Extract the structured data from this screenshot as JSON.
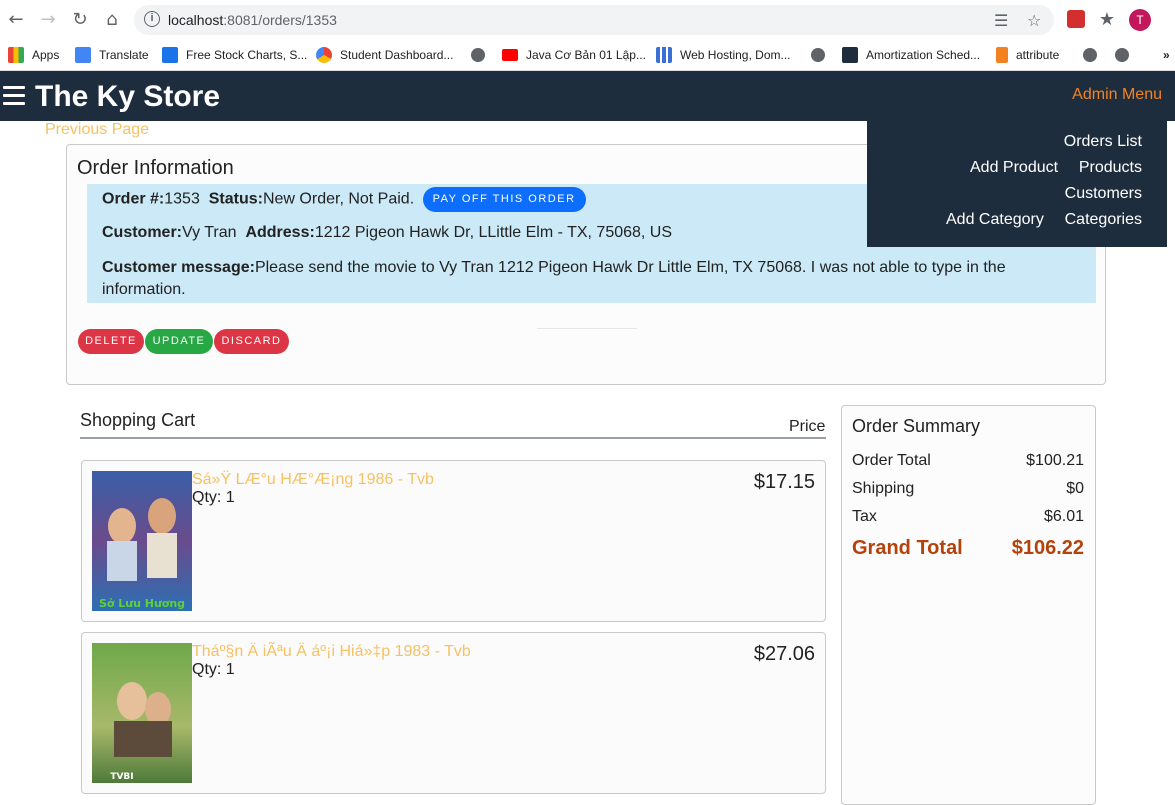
{
  "browser": {
    "url_host": "localhost",
    "url_rest": ":8081/orders/1353",
    "avatar_letter": "T",
    "bookmarks": [
      {
        "label": "Apps",
        "icon": "apps-grid-icon"
      },
      {
        "label": "Translate",
        "icon": "translate-icon"
      },
      {
        "label": "Free Stock Charts, S...",
        "icon": "chart-cloud-icon"
      },
      {
        "label": "Student Dashboard...",
        "icon": "dashboard-icon"
      },
      {
        "label": "Java Cơ Bản 01 Lập...",
        "icon": "youtube-icon"
      },
      {
        "label": "Web Hosting, Dom...",
        "icon": "grid-icon"
      },
      {
        "label": "Amortization Sched...",
        "icon": "b-logo-icon"
      },
      {
        "label": "attribute",
        "icon": "bookmark-icon"
      }
    ]
  },
  "navbar": {
    "brand": "The Ky Store",
    "admin_menu": "Admin Menu",
    "dropdown": {
      "orders_list": "Orders List",
      "add_product": "Add Product",
      "products": "Products",
      "customers": "Customers",
      "add_category": "Add Category",
      "categories": "Categories"
    }
  },
  "prev_page": "Previous Page",
  "order": {
    "title": "Order Information",
    "number_label": "Order #:",
    "number": "1353",
    "status_label": "Status:",
    "status": "New Order, Not Paid.",
    "pay_button": "PAY OFF THIS ORDER",
    "customer_label": "Customer:",
    "customer": "Vy Tran",
    "address_label": "Address:",
    "address": "1212 Pigeon Hawk Dr, LLittle Elm - TX, 75068, US",
    "message_label": "Customer message:",
    "message": "Please send the movie to Vy Tran 1212 Pigeon Hawk Dr Little Elm, TX 75068. I was not able to type in the information.",
    "buttons": {
      "delete": "DELETE",
      "update": "UPDATE",
      "discard": "DISCARD"
    }
  },
  "cart": {
    "title": "Shopping Cart",
    "price_header": "Price",
    "items": [
      {
        "title": "Sá»Ÿ LÆ°u HÆ°Æ¡ng 1986 - Tvb",
        "qty": "Qty: 1",
        "price": "$17.15",
        "poster_caption": "Sở Lưu Hương"
      },
      {
        "title": "Tháº§n Ä iÃªu Ä áº¡i Hiá»‡p 1983 - Tvb",
        "qty": "Qty: 1",
        "price": "$27.06",
        "poster_caption": "TVBI"
      }
    ]
  },
  "summary": {
    "title": "Order Summary",
    "order_total_label": "Order Total",
    "order_total": "$100.21",
    "shipping_label": "Shipping",
    "shipping": "$0",
    "tax_label": "Tax",
    "tax": "$6.01",
    "grand_total_label": "Grand Total",
    "grand_total": "$106.22"
  },
  "colors": {
    "navbar_bg": "#1e2d3d",
    "accent_orange": "#f58220",
    "link_gold": "#f6c163",
    "info_box": "#cbe9f6",
    "primary_blue": "#0d6efd",
    "danger_red": "#dc3545",
    "success_green": "#28a745",
    "grand_total": "#b5410b"
  }
}
